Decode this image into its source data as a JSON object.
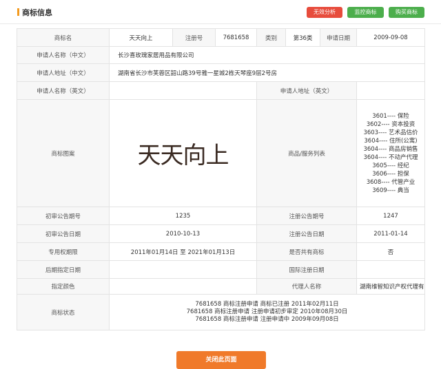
{
  "header": {
    "title": "商标信息",
    "buttons": {
      "invalid_analysis": "无效分析",
      "monitor": "监控商标",
      "buy": "购买商标"
    }
  },
  "labels": {
    "trademark_name": "商标名",
    "reg_no": "注册号",
    "class": "类别",
    "apply_date": "申请日期",
    "applicant_cn": "申请人名称（中文）",
    "address_cn": "申请人地址（中文）",
    "applicant_en": "申请人名称（英文）",
    "address_en": "申请人地址（英文）",
    "image": "商标图案",
    "services": "商品/服务列表",
    "prelim_no": "初审公告期号",
    "reg_ann_no": "注册公告期号",
    "prelim_date": "初审公告日期",
    "reg_ann_date": "注册公告日期",
    "exclusive_period": "专用权期限",
    "shared": "是否共有商标",
    "later_date": "后期指定日期",
    "intl_reg_date": "国际注册日期",
    "color": "指定颜色",
    "agent": "代理人名称",
    "status": "商标状态"
  },
  "values": {
    "trademark_name": "天天向上",
    "reg_no": "7681658",
    "class": "第36类",
    "apply_date": "2009-09-08",
    "applicant_cn": "长沙喜玫瑰家居用品有限公司",
    "address_cn": "湖南省长沙市芙蓉区韶山路39号雅一星城2栋天琴座9层2号房",
    "applicant_en": "",
    "address_en": "",
    "logo_text": "天天向上",
    "services": [
      "3601---- 保险",
      "3602---- 资本投资",
      "3603---- 艺术品估价",
      "3604---- 住所(公寓)",
      "3604---- 商品房销售",
      "3604---- 不动产代理",
      "3605---- 经纪",
      "3606---- 担保",
      "3608---- 代管产业",
      "3609---- 典当"
    ],
    "prelim_no": "1235",
    "reg_ann_no": "1247",
    "prelim_date": "2010-10-13",
    "reg_ann_date": "2011-01-14",
    "exclusive_period": "2011年01月14日 至 2021年01月13日",
    "shared": "否",
    "later_date": "",
    "intl_reg_date": "",
    "color": "",
    "agent": "湖南维智知识产权代理有限公司",
    "status": [
      "7681658 商标注册申请 商标已注册 2011年02月11日",
      "7681658 商标注册申请 注册申请初步审定 2010年08月30日",
      "7681658 商标注册申请 注册申请中 2009年09月08日"
    ]
  },
  "footer": {
    "close": "关闭此页面"
  },
  "colors": {
    "accent": "#f39a1e",
    "red_button": "#e74c3c",
    "green_button": "#4cae4c",
    "close_button": "#f07a2a"
  }
}
